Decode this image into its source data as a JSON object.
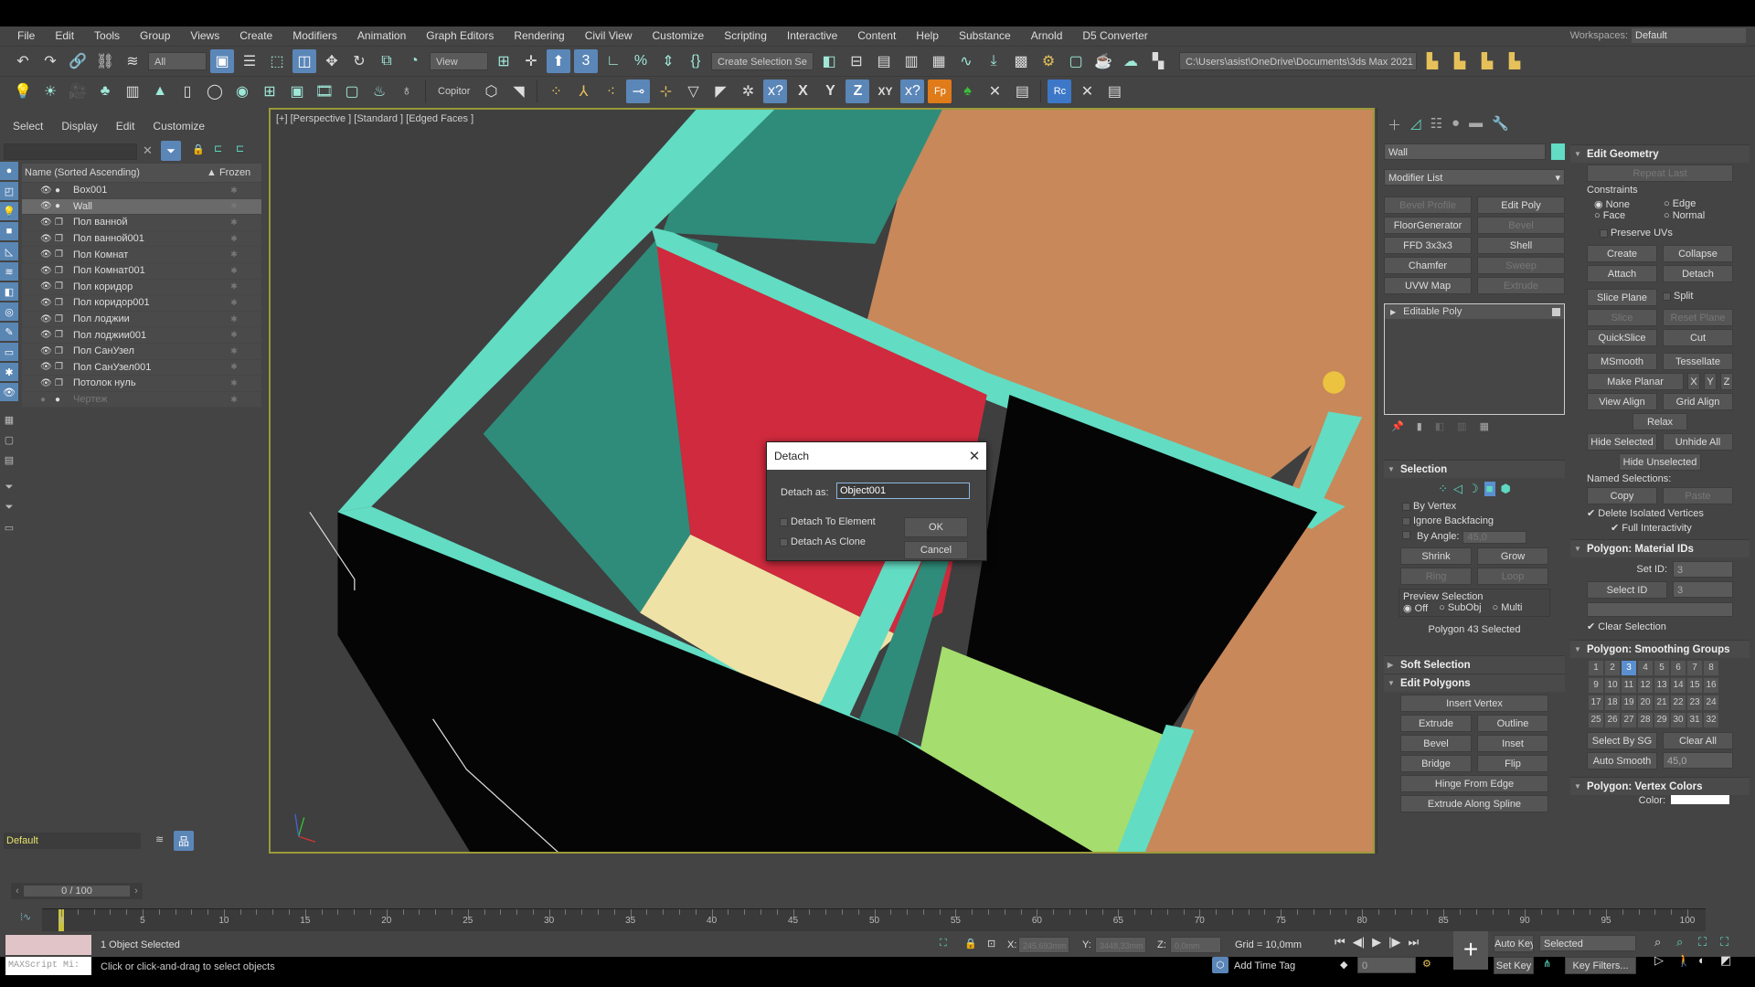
{
  "menu": [
    "File",
    "Edit",
    "Tools",
    "Group",
    "Views",
    "Create",
    "Modifiers",
    "Animation",
    "Graph Editors",
    "Rendering",
    "Civil View",
    "Customize",
    "Scripting",
    "Interactive",
    "Content",
    "Help",
    "Substance",
    "Arnold",
    "D5 Converter"
  ],
  "workspace": {
    "label": "Workspaces:",
    "value": "Default"
  },
  "toolbar1": {
    "filter": "All",
    "ref_coord": "View",
    "selection_set": "Create Selection Se",
    "project_path": "C:\\Users\\asist\\OneDrive\\Documents\\3ds Max 2021"
  },
  "toolbar2": {
    "copitor": "Copitor",
    "axis_x": "X",
    "axis_y": "Y",
    "axis_z": "Z",
    "axis_xy": "XY"
  },
  "scene_explorer": {
    "menu": [
      "Select",
      "Display",
      "Edit",
      "Customize"
    ],
    "col_name": "Name (Sorted Ascending)",
    "col_frozen": "▲ Frozen",
    "rows": [
      {
        "name": "Box001",
        "type": "geo"
      },
      {
        "name": "Wall",
        "type": "geo",
        "selected": true
      },
      {
        "name": "Пол ванной",
        "type": "group"
      },
      {
        "name": "Пол ванной001",
        "type": "group"
      },
      {
        "name": "Пол Комнат",
        "type": "group"
      },
      {
        "name": "Пол Комнат001",
        "type": "group"
      },
      {
        "name": "Пол коридор",
        "type": "group"
      },
      {
        "name": "Пол коридор001",
        "type": "group"
      },
      {
        "name": "Пол лоджии",
        "type": "group"
      },
      {
        "name": "Пол лоджии001",
        "type": "group"
      },
      {
        "name": "Пол СанУзел",
        "type": "group"
      },
      {
        "name": "Пол СанУзел001",
        "type": "group"
      },
      {
        "name": "Потолок нуль",
        "type": "group"
      },
      {
        "name": "Чертеж",
        "type": "geo",
        "hidden": true
      }
    ],
    "layer": "Default"
  },
  "viewport": {
    "label": "[+] [Perspective ] [Standard ] [Edged Faces ]",
    "colors": {
      "wall": "#62dcc3",
      "floor_dark": "#2f8c7a",
      "wood": "#c8885a",
      "red": "#cf2a3d",
      "yellow": "#efe2a6",
      "green": "#a5dd6e",
      "black": "#050505"
    }
  },
  "dialog": {
    "title": "Detach",
    "detach_as_label": "Detach as:",
    "detach_as_value": "Object001",
    "to_element": "Detach To Element",
    "as_clone": "Detach As Clone",
    "ok": "OK",
    "cancel": "Cancel"
  },
  "command_panel": {
    "object_name": "Wall",
    "object_color": "#62dcc3",
    "modifier_list": "Modifier List",
    "modifier_buttons": [
      {
        "label": "Bevel Profile",
        "enabled": false
      },
      {
        "label": "Edit Poly",
        "enabled": true
      },
      {
        "label": "FloorGenerator",
        "enabled": true
      },
      {
        "label": "Bevel",
        "enabled": false
      },
      {
        "label": "FFD 3x3x3",
        "enabled": true
      },
      {
        "label": "Shell",
        "enabled": true
      },
      {
        "label": "Chamfer",
        "enabled": true
      },
      {
        "label": "Sweep",
        "enabled": false
      },
      {
        "label": "UVW Map",
        "enabled": true
      },
      {
        "label": "Extrude",
        "enabled": false
      }
    ],
    "stack": [
      "Editable Poly"
    ],
    "selection": {
      "title": "Selection",
      "by_vertex": "By Vertex",
      "ignore_backfacing": "Ignore Backfacing",
      "by_angle": "By Angle:",
      "angle": "45,0",
      "shrink": "Shrink",
      "grow": "Grow",
      "ring": "Ring",
      "loop": "Loop",
      "preview": "Preview Selection",
      "off": "Off",
      "subobj": "SubObj",
      "multi": "Multi",
      "status": "Polygon 43 Selected"
    },
    "soft_selection": "Soft Selection",
    "edit_polygons": {
      "title": "Edit Polygons",
      "insert_vertex": "Insert Vertex",
      "extrude": "Extrude",
      "outline": "Outline",
      "bevel": "Bevel",
      "inset": "Inset",
      "bridge": "Bridge",
      "flip": "Flip",
      "hinge": "Hinge From Edge",
      "extrude_spline": "Extrude Along Spline"
    },
    "edit_geometry": {
      "title": "Edit Geometry",
      "repeat_last": "Repeat Last",
      "constraints": "Constraints",
      "none": "None",
      "edge": "Edge",
      "face": "Face",
      "normal": "Normal",
      "preserve_uvs": "Preserve UVs",
      "create": "Create",
      "collapse": "Collapse",
      "attach": "Attach",
      "detach": "Detach",
      "slice_plane": "Slice Plane",
      "split": "Split",
      "slice": "Slice",
      "reset_plane": "Reset Plane",
      "quickslice": "QuickSlice",
      "cut": "Cut",
      "msmooth": "MSmooth",
      "tessellate": "Tessellate",
      "make_planar": "Make Planar",
      "x": "X",
      "y": "Y",
      "z": "Z",
      "view_align": "View Align",
      "grid_align": "Grid Align",
      "relax": "Relax",
      "hide_selected": "Hide Selected",
      "unhide_all": "Unhide All",
      "hide_unselected": "Hide Unselected",
      "named_selections": "Named Selections:",
      "copy": "Copy",
      "paste": "Paste",
      "delete_isolated": "Delete Isolated Vertices",
      "full_interactivity": "Full Interactivity"
    },
    "material_ids": {
      "title": "Polygon: Material IDs",
      "set_id_label": "Set ID:",
      "set_id": "3",
      "select_id": "Select ID",
      "select_id_value": "3",
      "clear_selection": "Clear Selection"
    },
    "smoothing": {
      "title": "Polygon: Smoothing Groups",
      "active": [
        3
      ],
      "select_by_sg": "Select By SG",
      "clear_all": "Clear All",
      "auto_smooth": "Auto Smooth",
      "auto_smooth_value": "45,0"
    },
    "vertex_colors": {
      "title": "Polygon: Vertex Colors",
      "color_label": "Color:"
    }
  },
  "timeline": {
    "slider": "0 / 100",
    "labels": [
      "0",
      "5",
      "10",
      "15",
      "20",
      "25",
      "30",
      "35",
      "40",
      "45",
      "50",
      "55",
      "60",
      "65",
      "70",
      "75",
      "80",
      "85",
      "90",
      "95",
      "100"
    ]
  },
  "status": {
    "selected": "1 Object Selected",
    "prompt": "Click or click-and-drag to select objects",
    "maxscript": "MAXScript Mi:",
    "x_label": "X:",
    "x": "245,693mm",
    "y_label": "Y:",
    "y": "3448,33mm",
    "z_label": "Z:",
    "z": "0,0mm",
    "grid": "Grid = 10,0mm",
    "add_time_tag": "Add Time Tag",
    "frame": "0",
    "auto_key": "Auto Key",
    "set_key": "Set Key",
    "key_mode": "Selected",
    "key_filters": "Key Filters..."
  }
}
